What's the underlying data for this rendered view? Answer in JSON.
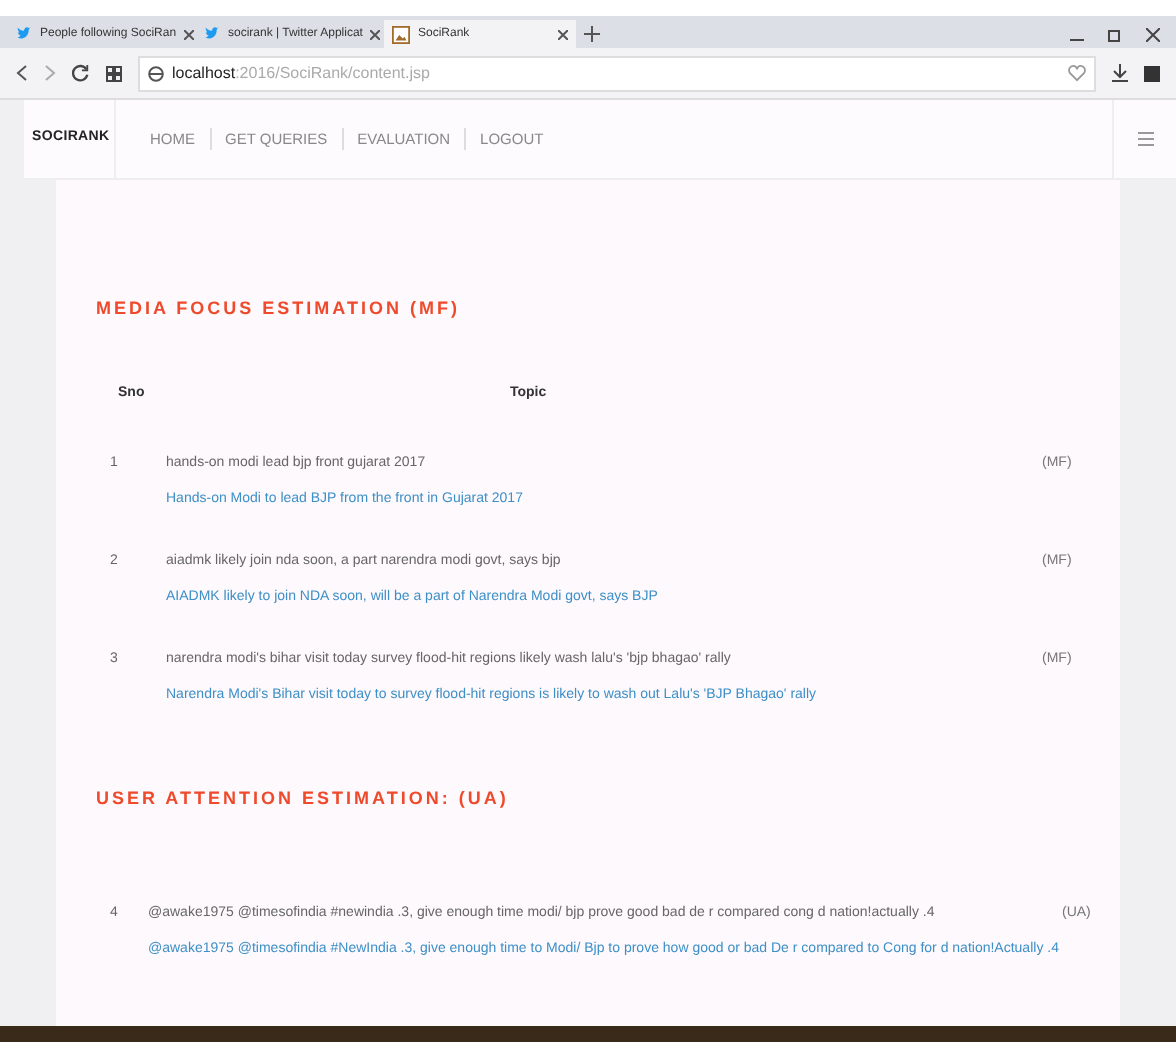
{
  "browser": {
    "tabs": [
      {
        "label": "People following SociRan",
        "kind": "twitter",
        "selected": false
      },
      {
        "label": "socirank | Twitter Applicat",
        "kind": "twitter",
        "selected": false
      },
      {
        "label": "SociRank",
        "kind": "page",
        "selected": true
      }
    ],
    "url": {
      "host": "localhost",
      "path": ":2016/SociRank/content.jsp"
    }
  },
  "nav": {
    "brand": "SOCIRANK",
    "items": [
      {
        "label": "HOME"
      },
      {
        "label": "GET QUERIES"
      },
      {
        "label": "EVALUATION"
      },
      {
        "label": "LOGOUT"
      }
    ]
  },
  "sections": [
    {
      "title": "MEDIA FOCUS ESTIMATION (MF)",
      "columns": [
        "Sno",
        "Topic"
      ],
      "rows": [
        {
          "sno": "1",
          "topic": "hands-on modi lead bjp front gujarat 2017",
          "link": "Hands-on Modi to lead BJP from the front in Gujarat 2017",
          "tag": "(MF)"
        },
        {
          "sno": "2",
          "topic": "aiadmk likely join nda soon, a part narendra modi govt, says bjp",
          "link": "AIADMK likely to join NDA soon, will be a part of Narendra Modi govt, says BJP",
          "tag": "(MF)"
        },
        {
          "sno": "3",
          "topic": "narendra modi's bihar visit today survey flood-hit regions likely wash lalu's 'bjp bhagao' rally",
          "link": "Narendra Modi's Bihar visit today to survey flood-hit regions is likely to wash out Lalu's 'BJP Bhagao' rally",
          "tag": "(MF)"
        }
      ]
    },
    {
      "title": "USER ATTENTION ESTIMATION: (UA)",
      "rows": [
        {
          "sno": "4",
          "topic": "@awake1975 @timesofindia #newindia .3, give enough time modi/ bjp prove good bad de r compared cong d nation!actually .4",
          "link": "@awake1975 @timesofindia #NewIndia .3, give enough time to Modi/ Bjp to prove how good or bad De r compared to Cong for d nation!Actually .4",
          "tag": "(UA)"
        }
      ]
    }
  ]
}
